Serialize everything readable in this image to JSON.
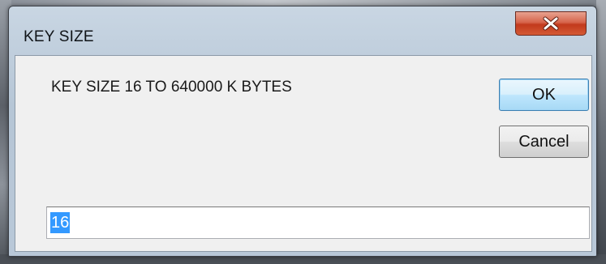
{
  "window": {
    "title": "KEY SIZE"
  },
  "dialog": {
    "prompt": "KEY SIZE 16 TO 640000 K BYTES",
    "ok_label": "OK",
    "cancel_label": "Cancel",
    "input_value": "16",
    "input_selected": true
  },
  "colors": {
    "close_button": "#c2391c",
    "selection": "#3399ff",
    "default_button_border": "#3c7fb1"
  },
  "icons": {
    "close": "close-icon"
  }
}
